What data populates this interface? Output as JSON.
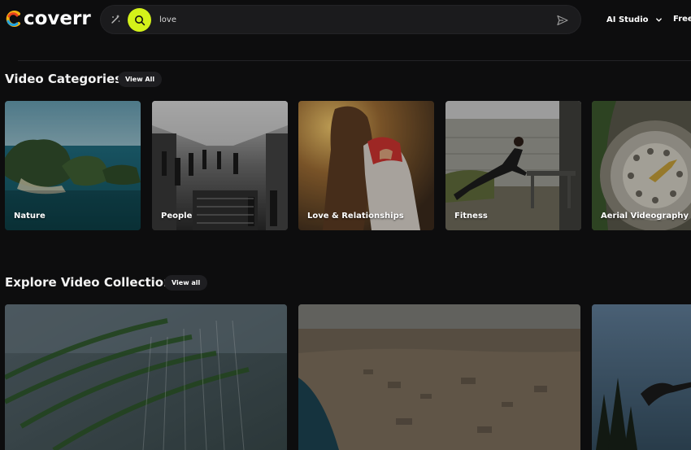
{
  "brand": {
    "name": "coverr"
  },
  "search": {
    "value": "love",
    "placeholder": ""
  },
  "nav": {
    "ai_studio": "AI Studio",
    "free": "Free"
  },
  "categories_section": {
    "title": "Video Categories",
    "view_all": "View All",
    "items": [
      {
        "label": "Nature"
      },
      {
        "label": "People"
      },
      {
        "label": "Love & Relationships"
      },
      {
        "label": "Fitness"
      },
      {
        "label": "Aerial Videography"
      }
    ]
  },
  "collections_section": {
    "title": "Explore Video Collections",
    "view_all": "View all"
  },
  "colors": {
    "accent": "#d4f21a",
    "background": "#0d0d0e"
  }
}
